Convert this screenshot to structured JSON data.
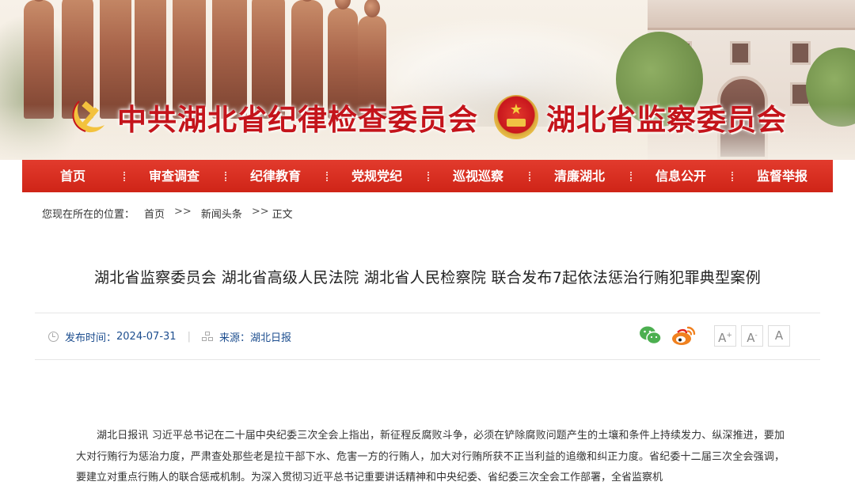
{
  "header": {
    "commission_title": "中共湖北省纪律检查委员会",
    "supervision_title": "湖北省监察委员会"
  },
  "nav": {
    "items": [
      "首页",
      "审查调查",
      "纪律教育",
      "党规党纪",
      "巡视巡察",
      "清廉湖北",
      "信息公开",
      "监督举报"
    ]
  },
  "breadcrumb": {
    "prefix": "您现在所在的位置：",
    "items": [
      "首页",
      "新闻头条",
      "正文"
    ],
    "separator": ">>"
  },
  "article": {
    "title": "湖北省监察委员会 湖北省高级人民法院 湖北省人民检察院 联合发布7起依法惩治行贿犯罪典型案例",
    "publish_label": "发布时间：",
    "publish_date": "2024-07-31",
    "source_label": "来源：",
    "source": "湖北日报",
    "font_sizes": [
      "A+",
      "A-",
      "A"
    ],
    "body": "湖北日报讯 习近平总书记在二十届中央纪委三次全会上指出，新征程反腐败斗争，必须在铲除腐败问题产生的土壤和条件上持续发力、纵深推进，要加大对行贿行为惩治力度，严肃查处那些老是拉干部下水、危害一方的行贿人，加大对行贿所获不正当利益的追缴和纠正力度。省纪委十二届三次全会强调，要建立对重点行贿人的联合惩戒机制。为深入贯彻习近平总书记重要讲话精神和中央纪委、省纪委三次全会工作部署，全省监察机"
  },
  "colors": {
    "nav_red": "#d82a1d",
    "title_red": "#c4141b",
    "meta_blue": "#1d4e8f",
    "wechat_green": "#4caf50",
    "weibo_orange": "#f0811f"
  },
  "icons": [
    "party-emblem-icon",
    "national-emblem-icon",
    "clock-icon",
    "source-icon",
    "wechat-icon",
    "weibo-icon"
  ]
}
